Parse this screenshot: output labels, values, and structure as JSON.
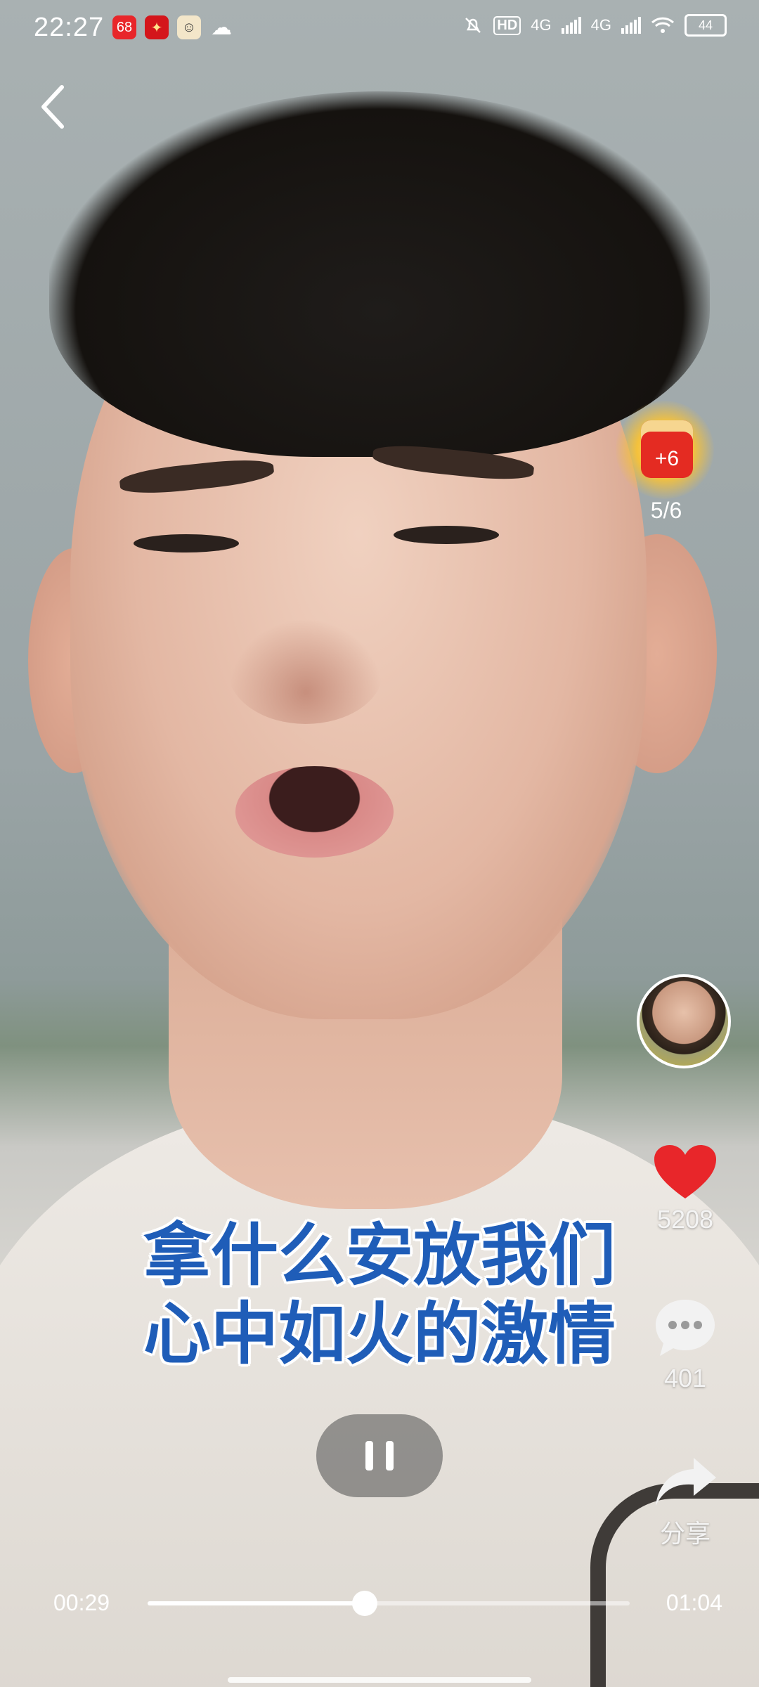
{
  "status_bar": {
    "time": "22:27",
    "network_1": "4G",
    "network_2": "4G",
    "hd_label": "HD",
    "battery": "44",
    "app_icons": [
      "app-icon-red-68",
      "app-icon-red-text",
      "app-icon-avatar",
      "cloud-icon"
    ]
  },
  "task_reward": {
    "bonus": "+6",
    "progress": "5/6"
  },
  "actions": {
    "likes": "5208",
    "comments": "401",
    "share_label": "分享"
  },
  "subtitle": {
    "line1": "拿什么安放我们",
    "line2": "心中如火的激情"
  },
  "player": {
    "current_time": "00:29",
    "total_time": "01:04",
    "progress": 0.45,
    "state": "playing"
  },
  "colors": {
    "subtitle_blue": "#1f5db8",
    "like_red": "#e8262a",
    "packet_red": "#e42b22"
  }
}
